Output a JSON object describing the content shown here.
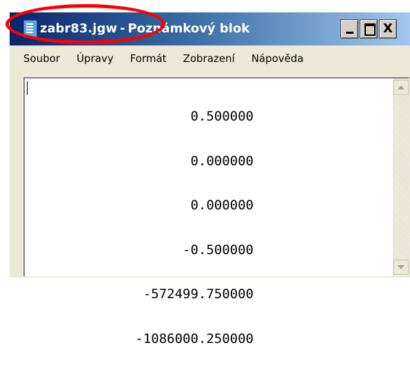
{
  "window": {
    "file_name": "zabr83.jgw",
    "separator": "-",
    "app_name": "Poznámkový blok",
    "title_bar_color": "#0a246a",
    "caption_buttons": {
      "minimize_icon": "minimize-icon",
      "maximize_icon": "maximize-icon",
      "close_label": "X"
    }
  },
  "menu": {
    "items": [
      "Soubor",
      "Úpravy",
      "Formát",
      "Zobrazení",
      "Nápověda"
    ]
  },
  "editor": {
    "lines": [
      "0.500000",
      "0.000000",
      "0.000000",
      "-0.500000",
      "-572499.750000",
      "-1086000.250000"
    ]
  },
  "annotation": {
    "color": "#ff0000"
  }
}
